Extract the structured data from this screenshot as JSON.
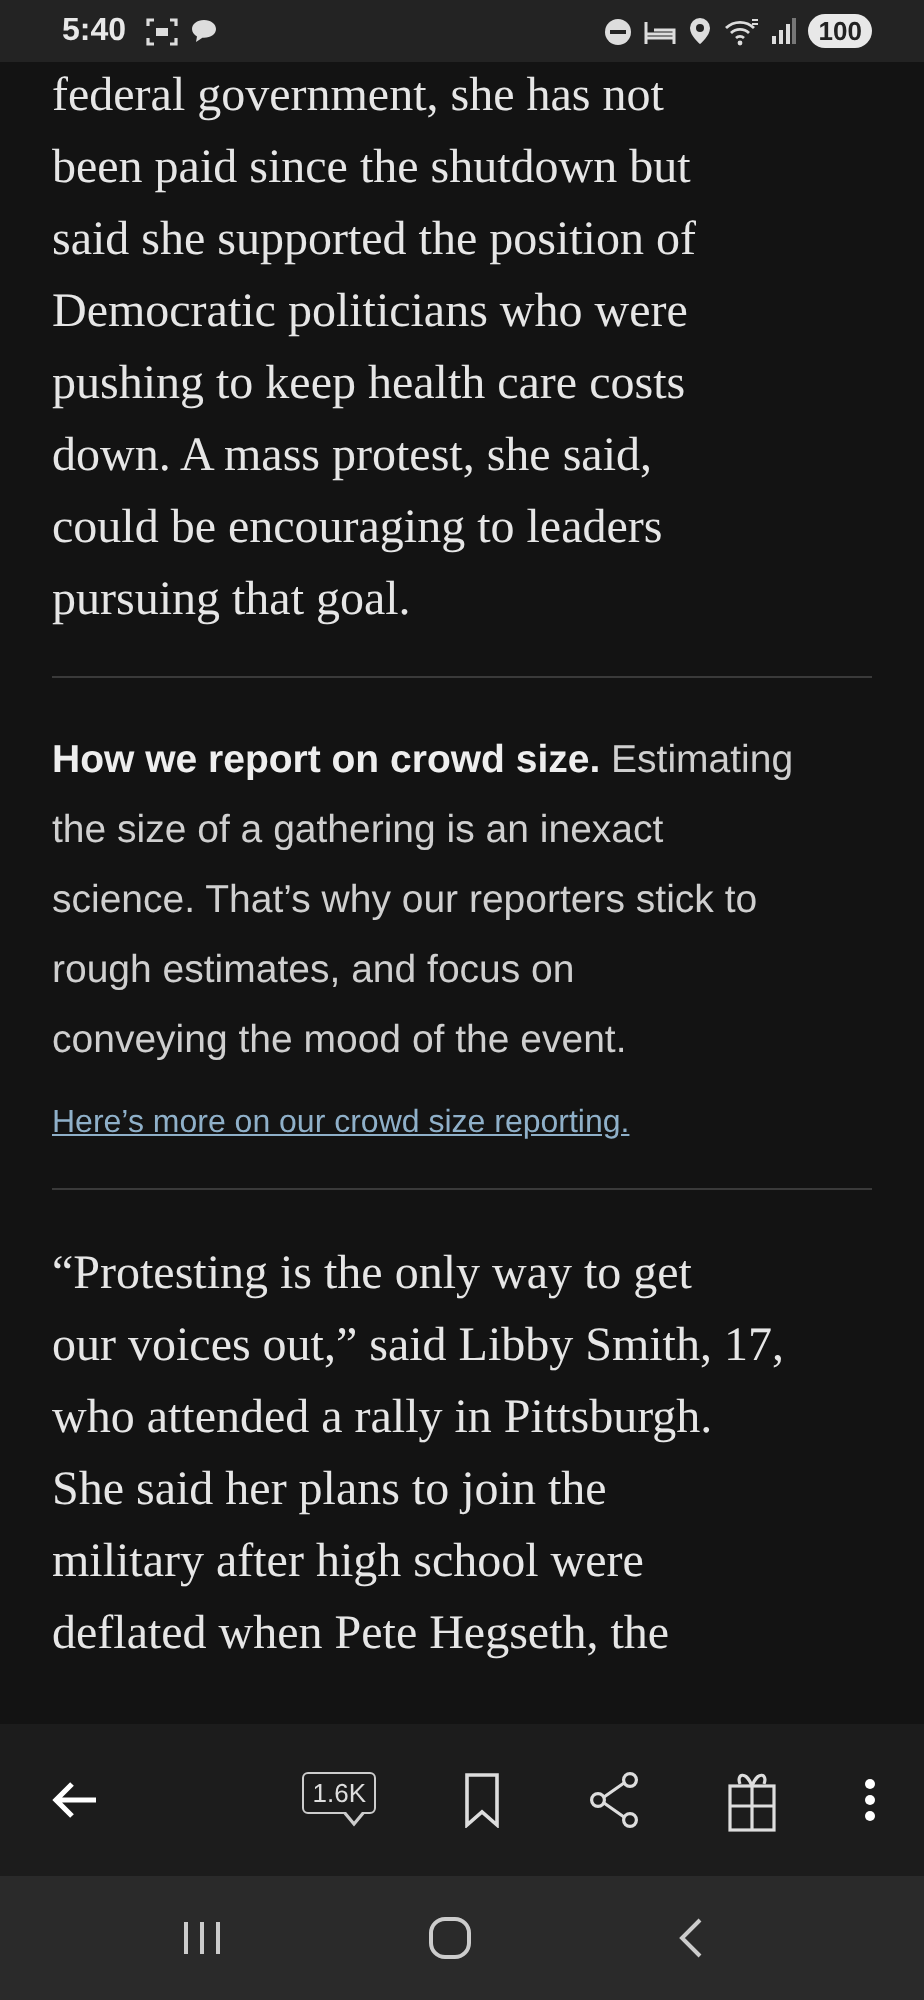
{
  "status_bar": {
    "time": "5:40",
    "battery": "100"
  },
  "article": {
    "paragraph_1": {
      "lines": [
        "federal government, she has not",
        "been paid since the shutdown but",
        "said she supported the position of",
        "Democratic politicians who were",
        "pushing to keep health care costs",
        "down. A mass protest, she said,",
        "could be encouraging to leaders",
        "pursuing that goal."
      ]
    },
    "note": {
      "lines": [
        "**How we report on crowd size.** Estimating",
        "the size of a gathering is an inexact",
        "science. That’s why our reporters stick to",
        "rough estimates, and focus on",
        "conveying the mood of the event."
      ],
      "link": "Here’s more on our crowd size reporting."
    },
    "paragraph_2": {
      "lines": [
        "“Protesting is the only way to get",
        "our voices out,” said Libby Smith, 17,",
        "who attended a rally in Pittsburgh.",
        "She said her plans to join the",
        "military after high school were",
        "deflated when Pete Hegseth, the"
      ]
    }
  },
  "toolbar": {
    "comment_count": "1.6K"
  }
}
